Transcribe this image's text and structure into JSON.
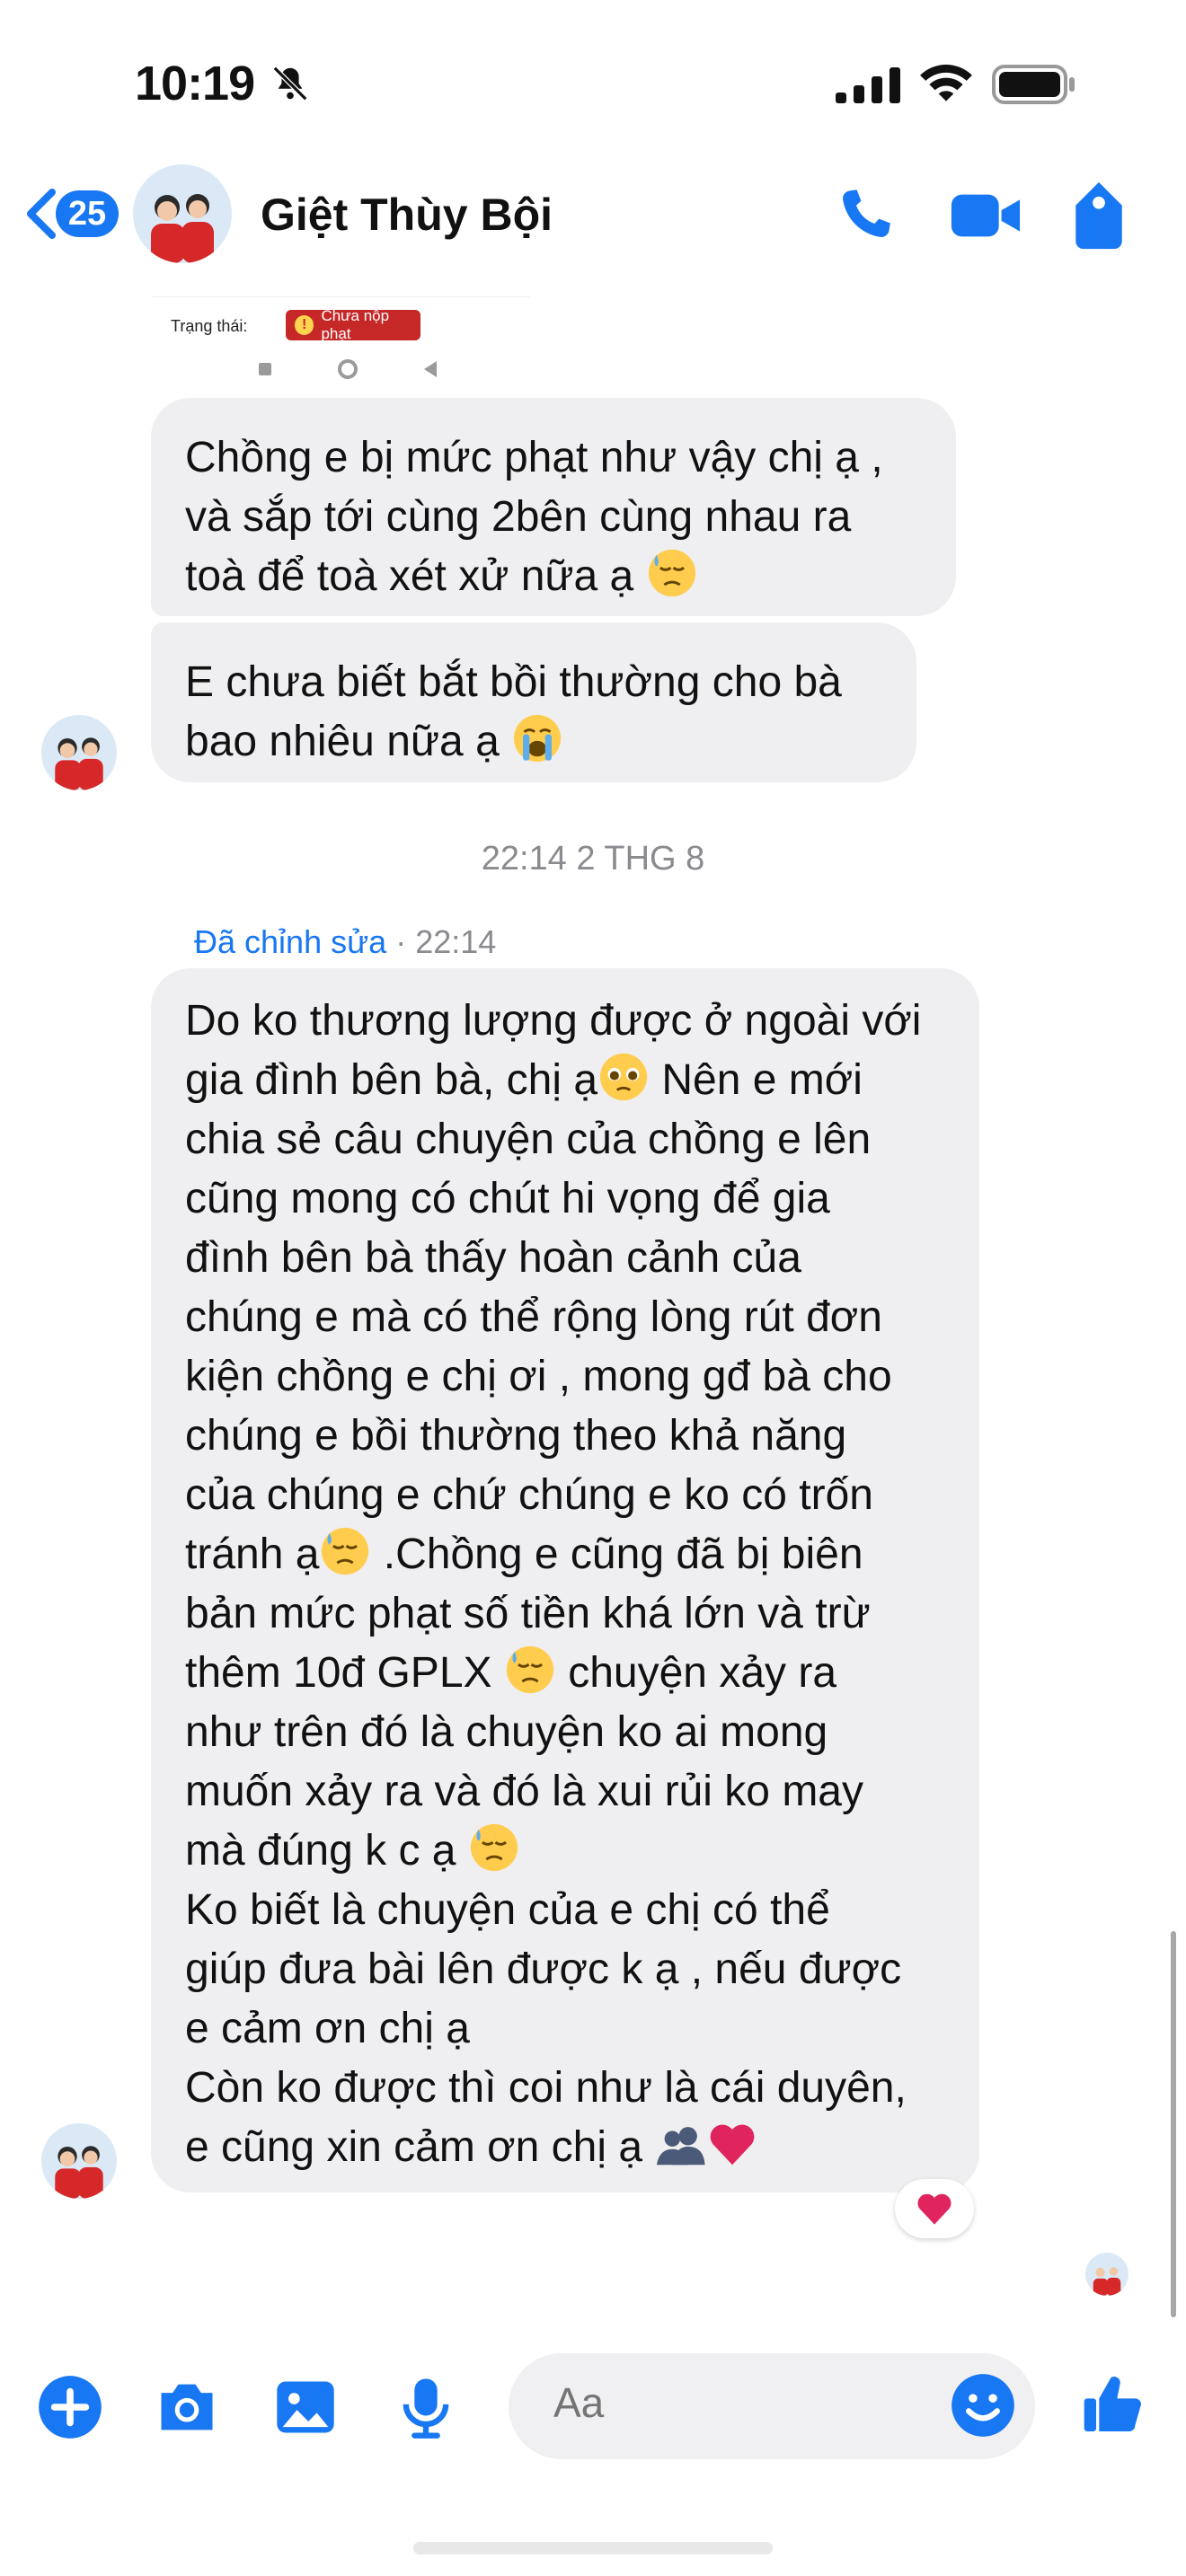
{
  "status_bar": {
    "time": "10:19"
  },
  "header": {
    "back_badge": "25",
    "contact_name": "Giệt Thùy Bội"
  },
  "screenshot_fragment": {
    "field_label": "Trạng thái:",
    "status_badge": "Chưa nộp phạt"
  },
  "messages": [
    {
      "text": "Chồng e bị mức phạt như vậy chị ạ ,\nvà sắp tới cùng 2bên cùng nhau ra\ntoà để toà xét xử nữa ạ ",
      "emoji": "sweat-face"
    },
    {
      "text": "E chưa biết bắt bồi thường cho bà\nbao nhiêu nữa ạ ",
      "emoji": "crying-face"
    }
  ],
  "timestamp": "22:14 2 THG 8",
  "edited": {
    "label": "Đã chỉnh sửa",
    "time": " · 22:14"
  },
  "long_message": {
    "p1": "Do ko thương lượng được ở ngoài với\ngia đình bên bà, chị ạ",
    "p2": " Nên e mới\nchia sẻ câu chuyện của chồng e lên\ncũng mong có chút hi vọng để gia\nđình bên bà thấy hoàn cảnh của\nchúng e mà có thể rộng lòng rút đơn\nkiện chồng e chị ơi , mong gđ bà cho\nchúng e bồi thường theo khả năng\ncủa chúng e chứ chúng e ko có trốn\ntránh ạ",
    "p3": " .Chồng e cũng đã bị biên\nbản mức phạt số tiền khá lớn và trừ\nthêm 10đ GPLX ",
    "p4": " chuyện xảy ra\nnhư trên đó là chuyện ko ai mong\nmuốn xảy ra và đó là xui rủi ko may\nmà đúng k c ạ ",
    "p5": "\nKo biết là chuyện của e chị có thể\ngiúp đưa bài lên được k ạ , nếu được\ne cảm ơn chị ạ\nCòn ko được thì coi như là cái duyên,\ne cũng xin cảm ơn chị ạ "
  },
  "composer": {
    "placeholder": "Aa"
  },
  "colors": {
    "accent": "#1877f2",
    "bubble": "#efeff1",
    "heart": "#e0245e"
  }
}
